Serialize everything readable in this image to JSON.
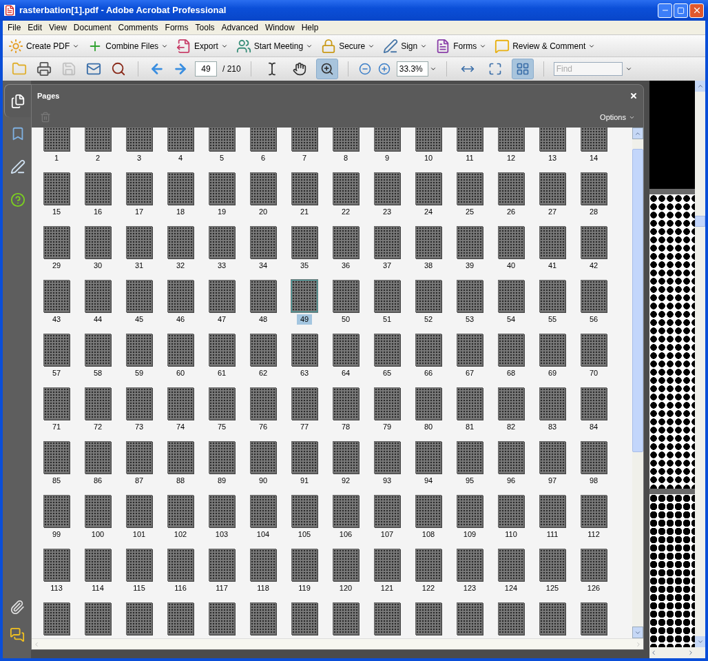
{
  "window": {
    "title": "rasterbation[1].pdf - Adobe Acrobat Professional"
  },
  "menu": [
    "File",
    "Edit",
    "View",
    "Document",
    "Comments",
    "Forms",
    "Tools",
    "Advanced",
    "Window",
    "Help"
  ],
  "task_toolbar": [
    {
      "kind": "create-pdf",
      "label": "Create PDF"
    },
    {
      "kind": "combine",
      "label": "Combine Files"
    },
    {
      "kind": "export",
      "label": "Export"
    },
    {
      "kind": "meeting",
      "label": "Start Meeting"
    },
    {
      "kind": "secure",
      "label": "Secure"
    },
    {
      "kind": "sign",
      "label": "Sign"
    },
    {
      "kind": "forms",
      "label": "Forms"
    },
    {
      "kind": "review",
      "label": "Review & Comment"
    }
  ],
  "file_buttons": [
    {
      "kind": "open",
      "disabled": false
    },
    {
      "kind": "print",
      "disabled": false
    },
    {
      "kind": "save",
      "disabled": true
    },
    {
      "kind": "email",
      "disabled": false
    },
    {
      "kind": "browse",
      "disabled": false
    }
  ],
  "page_field": {
    "value": "49"
  },
  "page_count": "/ 210",
  "tools": [
    {
      "kind": "select",
      "selected": false
    },
    {
      "kind": "hand",
      "selected": false
    },
    {
      "kind": "marquee-zoom",
      "selected": true
    }
  ],
  "zoom_field": {
    "value": "33.3%"
  },
  "layout_buttons": [
    {
      "kind": "fit-width",
      "selected": false
    },
    {
      "kind": "fit-page",
      "selected": false
    },
    {
      "kind": "two-up",
      "selected": true
    }
  ],
  "find_field": {
    "placeholder": "Find"
  },
  "navigation_panel": {
    "items": [
      {
        "kind": "pages",
        "selected": true
      },
      {
        "kind": "bookmarks",
        "selected": false
      },
      {
        "kind": "signatures",
        "selected": false
      },
      {
        "kind": "help",
        "selected": false
      }
    ],
    "bottom_items": [
      {
        "kind": "attachments"
      },
      {
        "kind": "comments"
      }
    ]
  },
  "pages_panel": {
    "title": "Pages",
    "options": "Options",
    "delete_disabled": true,
    "thumbnails": [
      {
        "label": "1",
        "selected": false
      },
      {
        "label": "2",
        "selected": false
      },
      {
        "label": "3",
        "selected": false
      },
      {
        "label": "4",
        "selected": false
      },
      {
        "label": "5",
        "selected": false
      },
      {
        "label": "6",
        "selected": false
      },
      {
        "label": "7",
        "selected": false
      },
      {
        "label": "8",
        "selected": false
      },
      {
        "label": "9",
        "selected": false
      },
      {
        "label": "10",
        "selected": false
      },
      {
        "label": "11",
        "selected": false
      },
      {
        "label": "12",
        "selected": false
      },
      {
        "label": "13",
        "selected": false
      },
      {
        "label": "14",
        "selected": false
      },
      {
        "label": "15",
        "selected": false
      },
      {
        "label": "16",
        "selected": false
      },
      {
        "label": "17",
        "selected": false
      },
      {
        "label": "18",
        "selected": false
      },
      {
        "label": "19",
        "selected": false
      },
      {
        "label": "20",
        "selected": false
      },
      {
        "label": "21",
        "selected": false
      },
      {
        "label": "22",
        "selected": false
      },
      {
        "label": "23",
        "selected": false
      },
      {
        "label": "24",
        "selected": false
      },
      {
        "label": "25",
        "selected": false
      },
      {
        "label": "26",
        "selected": false
      },
      {
        "label": "27",
        "selected": false
      },
      {
        "label": "28",
        "selected": false
      },
      {
        "label": "29",
        "selected": false
      },
      {
        "label": "30",
        "selected": false
      },
      {
        "label": "31",
        "selected": false
      },
      {
        "label": "32",
        "selected": false
      },
      {
        "label": "33",
        "selected": false
      },
      {
        "label": "34",
        "selected": false
      },
      {
        "label": "35",
        "selected": false
      },
      {
        "label": "36",
        "selected": false
      },
      {
        "label": "37",
        "selected": false
      },
      {
        "label": "38",
        "selected": false
      },
      {
        "label": "39",
        "selected": false
      },
      {
        "label": "40",
        "selected": false
      },
      {
        "label": "41",
        "selected": false
      },
      {
        "label": "42",
        "selected": false
      },
      {
        "label": "43",
        "selected": false
      },
      {
        "label": "44",
        "selected": false
      },
      {
        "label": "45",
        "selected": false
      },
      {
        "label": "46",
        "selected": false
      },
      {
        "label": "47",
        "selected": false
      },
      {
        "label": "48",
        "selected": false
      },
      {
        "label": "49",
        "selected": true
      },
      {
        "label": "50",
        "selected": false
      },
      {
        "label": "51",
        "selected": false
      },
      {
        "label": "52",
        "selected": false
      },
      {
        "label": "53",
        "selected": false
      },
      {
        "label": "54",
        "selected": false
      },
      {
        "label": "55",
        "selected": false
      },
      {
        "label": "56",
        "selected": false
      },
      {
        "label": "57",
        "selected": false
      },
      {
        "label": "58",
        "selected": false
      },
      {
        "label": "59",
        "selected": false
      },
      {
        "label": "60",
        "selected": false
      },
      {
        "label": "61",
        "selected": false
      },
      {
        "label": "62",
        "selected": false
      },
      {
        "label": "63",
        "selected": false
      },
      {
        "label": "64",
        "selected": false
      },
      {
        "label": "65",
        "selected": false
      },
      {
        "label": "66",
        "selected": false
      },
      {
        "label": "67",
        "selected": false
      },
      {
        "label": "68",
        "selected": false
      },
      {
        "label": "69",
        "selected": false
      },
      {
        "label": "70",
        "selected": false
      },
      {
        "label": "71",
        "selected": false
      },
      {
        "label": "72",
        "selected": false
      },
      {
        "label": "73",
        "selected": false
      },
      {
        "label": "74",
        "selected": false
      },
      {
        "label": "75",
        "selected": false
      },
      {
        "label": "76",
        "selected": false
      },
      {
        "label": "77",
        "selected": false
      },
      {
        "label": "78",
        "selected": false
      },
      {
        "label": "79",
        "selected": false
      },
      {
        "label": "80",
        "selected": false
      },
      {
        "label": "81",
        "selected": false
      },
      {
        "label": "82",
        "selected": false
      },
      {
        "label": "83",
        "selected": false
      },
      {
        "label": "84",
        "selected": false
      },
      {
        "label": "85",
        "selected": false
      },
      {
        "label": "86",
        "selected": false
      },
      {
        "label": "87",
        "selected": false
      },
      {
        "label": "88",
        "selected": false
      },
      {
        "label": "89",
        "selected": false
      },
      {
        "label": "90",
        "selected": false
      },
      {
        "label": "91",
        "selected": false
      },
      {
        "label": "92",
        "selected": false
      },
      {
        "label": "93",
        "selected": false
      },
      {
        "label": "94",
        "selected": false
      },
      {
        "label": "95",
        "selected": false
      },
      {
        "label": "96",
        "selected": false
      },
      {
        "label": "97",
        "selected": false
      },
      {
        "label": "98",
        "selected": false
      },
      {
        "label": "99",
        "selected": false
      },
      {
        "label": "100",
        "selected": false
      },
      {
        "label": "101",
        "selected": false
      },
      {
        "label": "102",
        "selected": false
      },
      {
        "label": "103",
        "selected": false
      },
      {
        "label": "104",
        "selected": false
      },
      {
        "label": "105",
        "selected": false
      },
      {
        "label": "106",
        "selected": false
      },
      {
        "label": "107",
        "selected": false
      },
      {
        "label": "108",
        "selected": false
      },
      {
        "label": "109",
        "selected": false
      },
      {
        "label": "110",
        "selected": false
      },
      {
        "label": "111",
        "selected": false
      },
      {
        "label": "112",
        "selected": false
      },
      {
        "label": "113",
        "selected": false
      },
      {
        "label": "114",
        "selected": false
      },
      {
        "label": "115",
        "selected": false
      },
      {
        "label": "116",
        "selected": false
      },
      {
        "label": "117",
        "selected": false
      },
      {
        "label": "118",
        "selected": false
      },
      {
        "label": "119",
        "selected": false
      },
      {
        "label": "120",
        "selected": false
      },
      {
        "label": "121",
        "selected": false
      },
      {
        "label": "122",
        "selected": false
      },
      {
        "label": "123",
        "selected": false
      },
      {
        "label": "124",
        "selected": false
      },
      {
        "label": "125",
        "selected": false
      },
      {
        "label": "126",
        "selected": false
      },
      {
        "selected": false
      },
      {
        "selected": false
      },
      {
        "selected": false
      },
      {
        "selected": false
      },
      {
        "selected": false
      },
      {
        "selected": false
      },
      {
        "selected": false
      },
      {
        "selected": false
      },
      {
        "selected": false
      },
      {
        "selected": false
      },
      {
        "selected": false
      },
      {
        "selected": false
      },
      {
        "selected": false
      },
      {
        "selected": false
      }
    ]
  }
}
